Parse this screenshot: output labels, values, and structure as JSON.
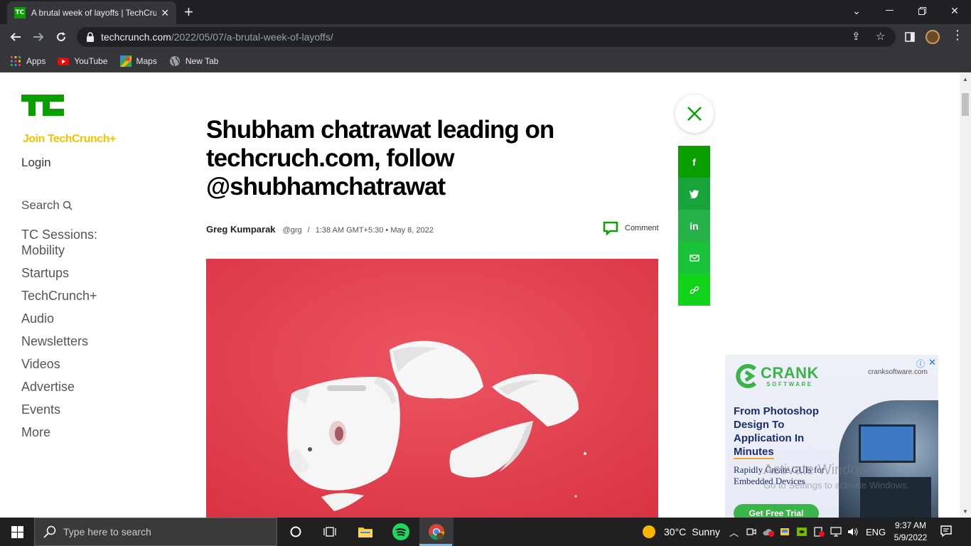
{
  "browser": {
    "tab_title": "A brutal week of layoffs | TechCrunch",
    "tab_favicon": "TC",
    "url_host": "techcrunch.com",
    "url_path": "/2022/05/07/a-brutal-week-of-layoffs/",
    "bookmarks": [
      {
        "label": "Apps",
        "icon": "apps-grid-icon"
      },
      {
        "label": "YouTube",
        "icon": "youtube-icon"
      },
      {
        "label": "Maps",
        "icon": "maps-icon"
      },
      {
        "label": "New Tab",
        "icon": "globe-icon"
      }
    ]
  },
  "sidebar": {
    "join": "Join TechCrunch+",
    "login": "Login",
    "search": "Search",
    "items": [
      "TC Sessions: Mobility",
      "Startups",
      "TechCrunch+",
      "Audio",
      "Newsletters",
      "Videos",
      "Advertise",
      "Events",
      "More"
    ]
  },
  "article": {
    "headline": "Shubham chatrawat leading on techcruch.com, follow @shubhamchatrawat",
    "author": "Greg Kumparak",
    "handle": "@grg",
    "separator": "/",
    "timestamp": "1:38 AM GMT+5:30 • May 8, 2022",
    "comment_label": "Comment"
  },
  "share": {
    "buttons": [
      {
        "name": "share-facebook-button",
        "glyph": "f",
        "color": "#0a9e01"
      },
      {
        "name": "share-twitter-button",
        "glyph": "t",
        "color": "#18a43a"
      },
      {
        "name": "share-linkedin-button",
        "glyph": "in",
        "color": "#26b248"
      },
      {
        "name": "share-email-button",
        "glyph": "mail",
        "color": "#1ac23a"
      },
      {
        "name": "share-link-button",
        "glyph": "link",
        "color": "#12d21a"
      }
    ]
  },
  "ad": {
    "brand": "CRANK",
    "brand_sub": "SOFTWARE",
    "domain": "cranksoftware.com",
    "headline_lines": [
      "From Photoshop",
      "Design To",
      "Application In",
      "Minutes"
    ],
    "description": "Rapidly Create GUIs for Embedded Devices",
    "cta": "Get Free Trial"
  },
  "watermark": {
    "line1": "Activate Windows",
    "line2": "Go to Settings to activate Windows."
  },
  "taskbar": {
    "search_placeholder": "Type here to search",
    "weather_temp": "30°C",
    "weather_desc": "Sunny",
    "language": "ENG",
    "time": "9:37 AM",
    "date": "5/9/2022"
  },
  "colors": {
    "tc_green": "#0a9e01",
    "join_yellow": "#f5c400",
    "hero_red": "#e8414f",
    "ad_green": "#3bb54a",
    "ad_navy": "#1b2d6b"
  }
}
